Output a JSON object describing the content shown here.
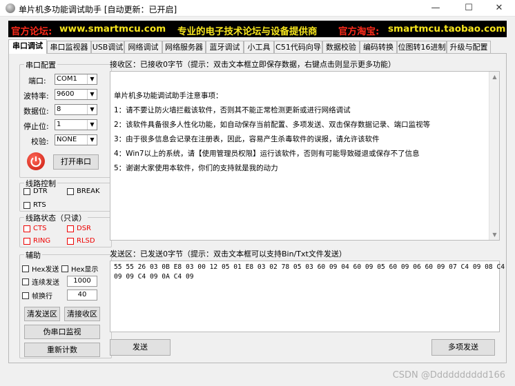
{
  "window": {
    "title": "单片机多功能调试助手 [自动更新：已开启]",
    "minimize": "—",
    "maximize": "☐",
    "close": "✕"
  },
  "banner": {
    "forum_label": "官方论坛:",
    "forum_url": "www.smartmcu.com",
    "slogan": "专业的电子技术论坛与设备提供商",
    "shop_label": "官方淘宝:",
    "shop_url": "smartmcu.taobao.com"
  },
  "tabs": [
    "串口调试",
    "串口监视器",
    "USB调试",
    "网络调试",
    "网络服务器",
    "蓝牙调试",
    "小工具",
    "C51代码向导",
    "数据校验",
    "编码转换",
    "位图转16进制",
    "升级与配置"
  ],
  "serial_config": {
    "title": "串口配置",
    "port_label": "端口:",
    "port_value": "COM1",
    "baud_label": "波特率:",
    "baud_value": "9600",
    "databits_label": "数据位:",
    "databits_value": "8",
    "stopbits_label": "停止位:",
    "stopbits_value": "1",
    "parity_label": "校验:",
    "parity_value": "NONE",
    "open_button": "打开串口"
  },
  "line_control": {
    "title": "线路控制",
    "dtr": "DTR",
    "break": "BREAK",
    "rts": "RTS"
  },
  "line_status": {
    "title": "线路状态（只读）",
    "cts": "CTS",
    "dsr": "DSR",
    "ring": "RING",
    "rlsd": "RLSD"
  },
  "aux": {
    "title": "辅助",
    "hex_send": "Hex发送",
    "hex_display": "Hex显示",
    "continuous_send": "连续发送",
    "continuous_value": "1000",
    "frame_newline": "帧换行",
    "frame_value": "40",
    "clear_send": "清发送区",
    "clear_recv": "清接收区",
    "virtual_monitor": "伪串口监视",
    "reset_count": "重新计数"
  },
  "recv": {
    "title": "接收区：已接收0字节（提示：双击文本框立即保存数据，右键点击则显示更多功能）",
    "lines": [
      "单片机多功能调试助手注意事项：",
      "1：请不要让防火墙拦截该软件，否则其不能正常检测更新或进行网络调试",
      "2：该软件具备很多人性化功能，如自动保存当前配置、多项发送、双击保存数据记录、端口监视等",
      "3：由于很多信息会记录在注册表，因此，容易产生杀毒软件的误报，请允许该软件",
      "4：Win7以上的系统，请【使用管理员权限】运行该软件，否则有可能导致碰退或保存不了信息",
      "5：谢谢大家使用本软件，你们的支持就是我的动力"
    ]
  },
  "send": {
    "title": "发送区：已发送0字节（提示：双击文本框可以支持Bin/Txt文件发送）",
    "line1": "55 55 26 03 0B E8 03 00 12 05 01 E8 03 02 78 05 03 60 09 04 60 09 05 60 09 06 60 09 07 C4 09 08 C4",
    "line2": "09 09 C4 09 0A C4 09",
    "send_button": "发送",
    "multi_send_button": "多项发送"
  },
  "watermark": "CSDN @Dddddddddd166"
}
